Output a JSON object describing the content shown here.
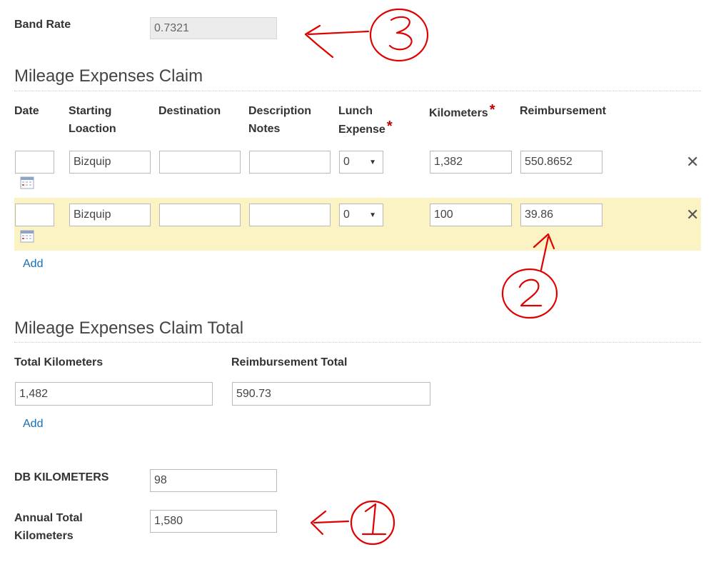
{
  "band_rate": {
    "label": "Band Rate",
    "value": "0.7321"
  },
  "claim": {
    "title": "Mileage Expenses Claim",
    "columns": {
      "date": "Date",
      "start_l1": "Starting",
      "start_l2": "Loaction",
      "destination": "Destination",
      "desc_l1": "Description",
      "desc_l2": "Notes",
      "lunch_l1": "Lunch",
      "lunch_l2": "Expense",
      "kilometers": "Kilometers",
      "reimbursement": "Reimbursement",
      "required_mark": "*"
    },
    "rows": [
      {
        "date": "",
        "start": "Bizquip",
        "destination": "",
        "notes": "",
        "lunch": "0",
        "kilometers": "1,382",
        "reimbursement": "550.8652"
      },
      {
        "date": "",
        "start": "Bizquip",
        "destination": "",
        "notes": "",
        "lunch": "0",
        "kilometers": "100",
        "reimbursement": "39.86"
      }
    ],
    "add_label": "Add",
    "delete_glyph": "✕",
    "select_arrow": "▼"
  },
  "total": {
    "title": "Mileage Expenses Claim Total",
    "km_label": "Total Kilometers",
    "km_value": "1,482",
    "reimb_label": "Reimbursement Total",
    "reimb_value": "590.73",
    "add_label": "Add"
  },
  "db_km": {
    "label": "DB KILOMETERS",
    "value": "98"
  },
  "annual": {
    "label_l1": "Annual Total",
    "label_l2": "Kilometers",
    "value": "1,580"
  },
  "icons": {
    "calendar": "calendar-icon",
    "delete": "close-icon"
  },
  "colors": {
    "highlight": "#fbf3c4",
    "link": "#1a6fb5",
    "required": "#c00000",
    "annotation": "#e00000"
  }
}
